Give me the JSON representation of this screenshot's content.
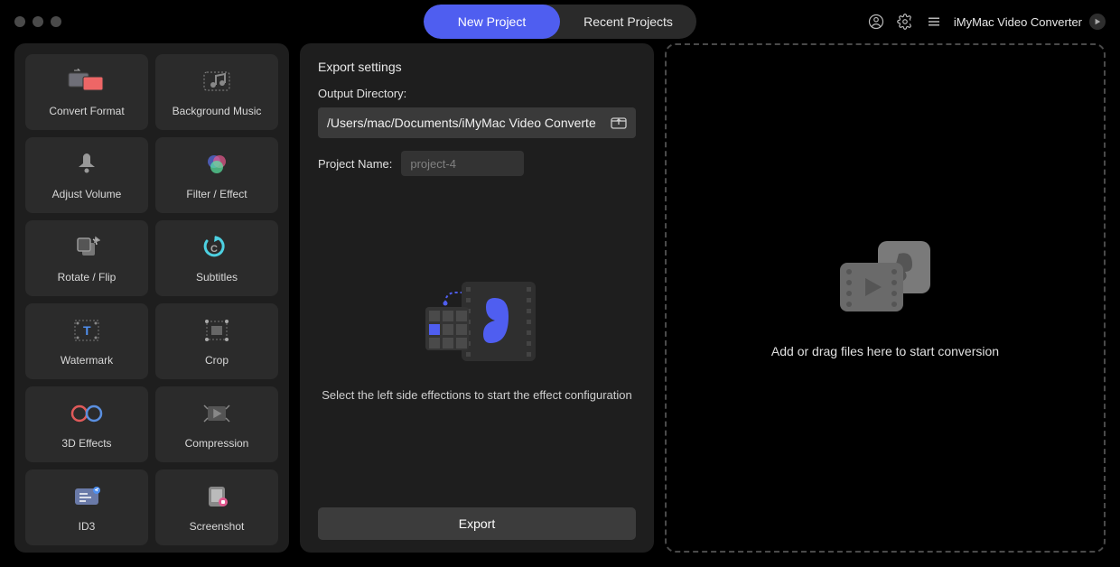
{
  "titlebar": {
    "tab_new": "New Project",
    "tab_recent": "Recent Projects",
    "app_name": "iMyMac Video Converter"
  },
  "sidebar": {
    "items": [
      {
        "label": "Convert Format"
      },
      {
        "label": "Background Music"
      },
      {
        "label": "Adjust Volume"
      },
      {
        "label": "Filter / Effect"
      },
      {
        "label": "Rotate / Flip"
      },
      {
        "label": "Subtitles"
      },
      {
        "label": "Watermark"
      },
      {
        "label": "Crop"
      },
      {
        "label": "3D Effects"
      },
      {
        "label": "Compression"
      },
      {
        "label": "ID3"
      },
      {
        "label": "Screenshot"
      }
    ]
  },
  "export": {
    "heading": "Export settings",
    "output_label": "Output Directory:",
    "output_path": "/Users/mac/Documents/iMyMac Video Converte",
    "project_name_label": "Project Name:",
    "project_name_placeholder": "project-4",
    "hint": "Select the left side effections to start the effect configuration",
    "button": "Export"
  },
  "dropzone": {
    "hint": "Add or drag files here to start conversion"
  }
}
